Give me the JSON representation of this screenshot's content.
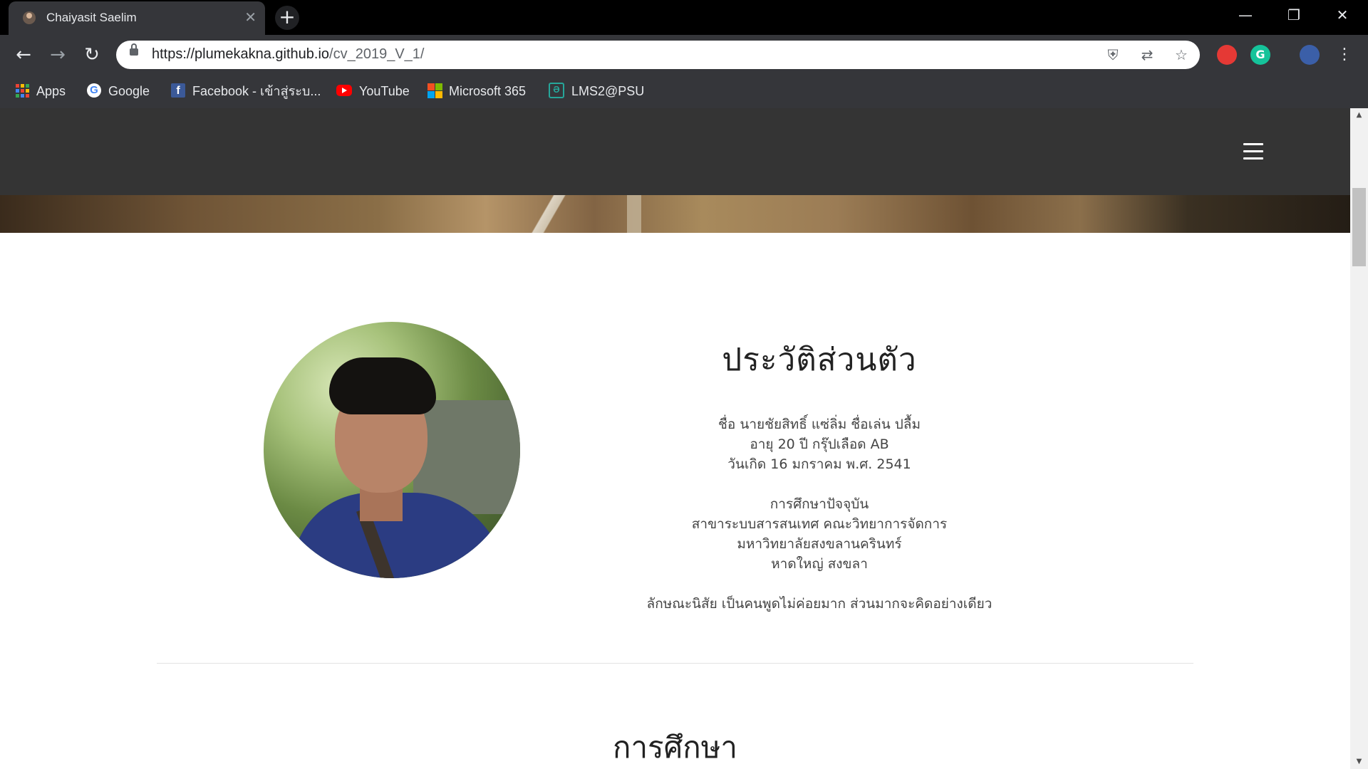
{
  "browser": {
    "tab_title": "Chaiyasit Saelim",
    "tab_close": "✕",
    "new_tab": "+",
    "url_host": "https://plumekakna.github.io",
    "url_path": "/cv_2019_V_1/",
    "window_controls": {
      "minimize": "—",
      "restore": "❐",
      "close": "✕"
    },
    "nav": {
      "back": "←",
      "forward": "→",
      "reload": "↻"
    },
    "bookmarks": [
      {
        "label": "Apps",
        "icon": "apps-grid-icon"
      },
      {
        "label": "Google",
        "icon": "google-icon"
      },
      {
        "label": "Facebook - เข้าสู่ระบ...",
        "icon": "facebook-icon"
      },
      {
        "label": "YouTube",
        "icon": "youtube-icon"
      },
      {
        "label": "Microsoft 365",
        "icon": "microsoft-icon"
      },
      {
        "label": "LMS2@PSU",
        "icon": "lms-icon"
      }
    ]
  },
  "site": {
    "menu_icon": "hamburger-menu-icon",
    "about": {
      "title": "ประวัติส่วนตัว",
      "lines": [
        [
          "ชื่อ นายชัยสิทธิ์ แซ่ลิ่ม ชื่อเล่น ปลื้ม",
          "อายุ 20 ปี กรุ๊ปเลือด AB",
          "วันเกิด 16 มกราคม พ.ศ. 2541"
        ],
        [
          "การศึกษาปัจจุบัน",
          "สาขาระบบสารสนเทศ คณะวิทยาการจัดการ",
          "มหาวิทยาลัยสงขลานครินทร์",
          "หาดใหญ่ สงขลา"
        ],
        [
          "ลักษณะนิสัย เป็นคนพูดไม่ค่อยมาก ส่วนมากจะคิดอย่างเดียว"
        ]
      ]
    },
    "education_title": "การศึกษา"
  },
  "colors": {
    "nav_bg": "#343434",
    "chrome_bg": "#35363a",
    "body_bg": "#ffffff"
  }
}
